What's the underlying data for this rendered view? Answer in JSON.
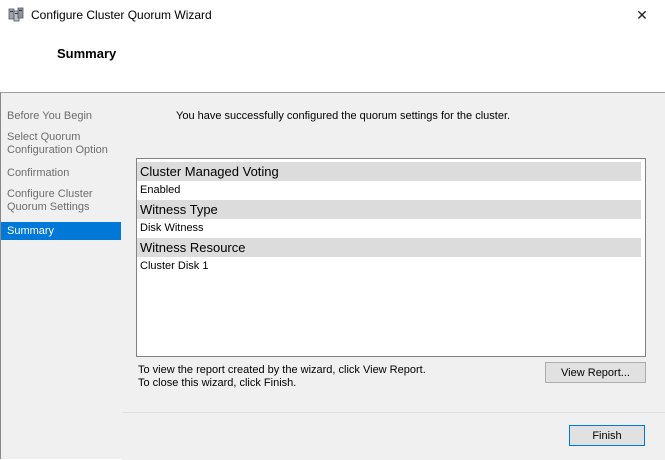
{
  "window": {
    "title": "Configure Cluster Quorum Wizard",
    "icon": "cluster-wizard-icon",
    "close_label": "✕"
  },
  "header": {
    "title": "Summary"
  },
  "nav": {
    "items": [
      {
        "label": "Before You Begin",
        "active": false
      },
      {
        "label": "Select Quorum Configuration Option",
        "active": false
      },
      {
        "label": "Confirmation",
        "active": false
      },
      {
        "label": "Configure Cluster Quorum Settings",
        "active": false
      },
      {
        "label": "Summary",
        "active": true
      }
    ]
  },
  "main": {
    "success_message": "You have successfully configured the quorum settings for the cluster.",
    "summary_sections": [
      {
        "heading": "Cluster Managed Voting",
        "value": "Enabled"
      },
      {
        "heading": "Witness Type",
        "value": "Disk Witness"
      },
      {
        "heading": "Witness Resource",
        "value": "Cluster Disk 1"
      }
    ],
    "footer_line1": "To view the report created by the wizard, click View Report.",
    "footer_line2": "To close this wizard, click Finish.",
    "view_report_label": "View Report...",
    "finish_label": "Finish"
  },
  "colors": {
    "accent": "#0078d7",
    "section_header_bg": "#dcdcdc",
    "nav_bg": "#f0f0f0"
  }
}
